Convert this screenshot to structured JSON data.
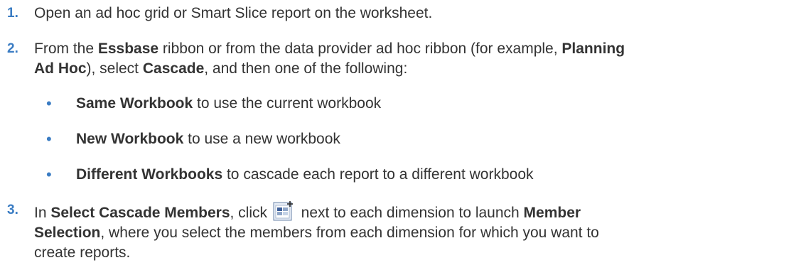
{
  "steps": [
    {
      "number": "1.",
      "text": "Open an ad hoc grid or Smart Slice report on the worksheet."
    },
    {
      "number": "2.",
      "part1": "From the ",
      "bold1": "Essbase",
      "part2": " ribbon or from the data provider ad hoc ribbon (for example, ",
      "bold2": "Planning",
      "bold3": "Ad Hoc",
      "part3": "), select ",
      "bold4": "Cascade",
      "part4": ", and then one of the following:"
    },
    {
      "number": "3.",
      "part1": "In ",
      "bold1": "Select Cascade Members",
      "part2": ", click ",
      "part3": " next to each dimension to launch ",
      "bold2": "Member",
      "bold3": "Selection",
      "part4": ", where you select the members from each dimension for which you want to",
      "part5": "create reports."
    }
  ],
  "options": [
    {
      "bullet": "•",
      "bold": "Same Workbook",
      "text": " to use the current workbook"
    },
    {
      "bullet": "•",
      "bold": "New Workbook",
      "text": " to use a new workbook"
    },
    {
      "bullet": "•",
      "bold": "Different Workbooks",
      "text": " to cascade each report to a different workbook"
    }
  ],
  "icons": {
    "member_selection": "member-selection-icon"
  }
}
